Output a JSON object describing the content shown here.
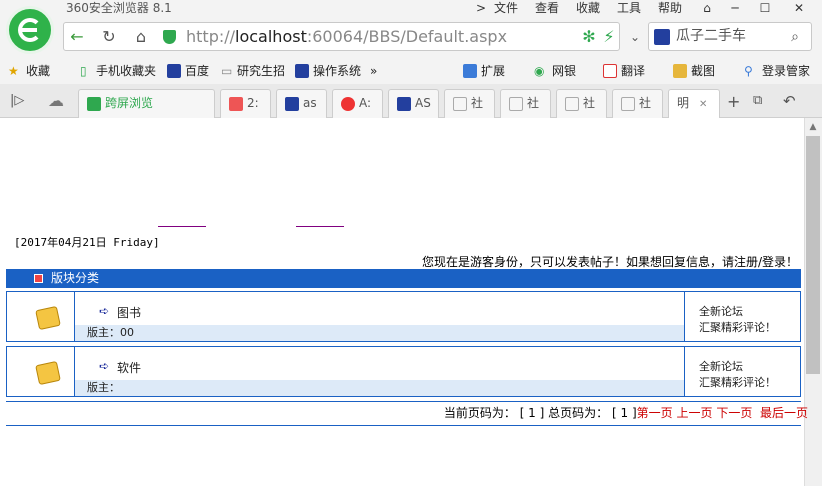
{
  "browser": {
    "app_title": "360安全浏览器 8.1",
    "menu": [
      "文件",
      "查看",
      "收藏",
      "工具",
      "帮助"
    ],
    "url_prefix": "http://",
    "url_host": "localhost",
    "url_rest": ":60064/BBS/Default.aspx",
    "search_text": "瓜子二手车",
    "bookmarks": [
      "收藏",
      "手机收藏夹",
      "百度",
      "研究生招",
      "操作系统",
      "扩展",
      "网银",
      "翻译",
      "截图",
      "登录管家"
    ],
    "tabs": [
      {
        "label": "跨屏浏览"
      },
      {
        "label": "2:"
      },
      {
        "label": "as"
      },
      {
        "label": "A:"
      },
      {
        "label": "AS"
      },
      {
        "label": "社"
      },
      {
        "label": "社"
      },
      {
        "label": "社"
      },
      {
        "label": "社"
      },
      {
        "label": "明"
      }
    ],
    "colors": {
      "accent": "#1a61c4",
      "logo": "#2fb24a"
    }
  },
  "page": {
    "date": "[2017年04月21日 Friday]",
    "notice": "您现在是游客身份，只可以发表帖子！如果想回复信息，请注册/登录！",
    "section_title": "版块分类",
    "forums": [
      {
        "name": "图书",
        "moderator": "版主：00",
        "desc_line1": "全新论坛",
        "desc_line2": "汇聚精彩评论！"
      },
      {
        "name": "软件",
        "moderator": "版主：",
        "desc_line1": "全新论坛",
        "desc_line2": "汇聚精彩评论！"
      }
    ],
    "pager": {
      "current_label": "当前页码为：",
      "current_value": "[ 1 ]",
      "total_label": "总页码为：",
      "total_value": "[ 1 ]",
      "first": "第一页",
      "prev": "上一页",
      "next": "下一页",
      "last": "最后一页"
    }
  }
}
